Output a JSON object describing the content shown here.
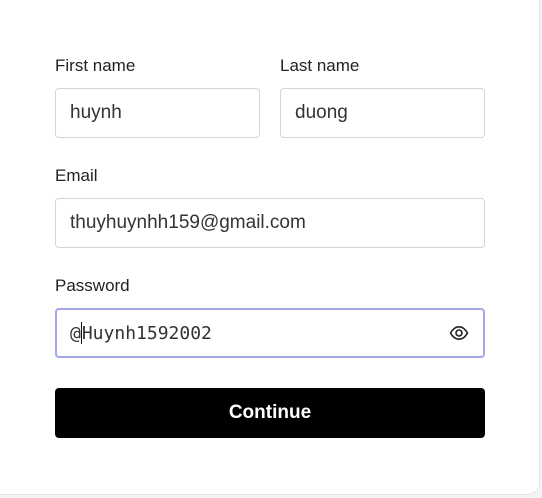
{
  "form": {
    "first_name": {
      "label": "First name",
      "value": "huynh"
    },
    "last_name": {
      "label": "Last name",
      "value": "duong"
    },
    "email": {
      "label": "Email",
      "value": "thuyhuynhh159@gmail.com"
    },
    "password": {
      "label": "Password",
      "value_before_caret": "@",
      "value_after_caret": "Huynh1592002",
      "toggle_icon": "eye-icon"
    },
    "submit_label": "Continue"
  },
  "colors": {
    "focus_border": "#a5a8e6",
    "button_bg": "#000000",
    "button_text": "#ffffff"
  }
}
